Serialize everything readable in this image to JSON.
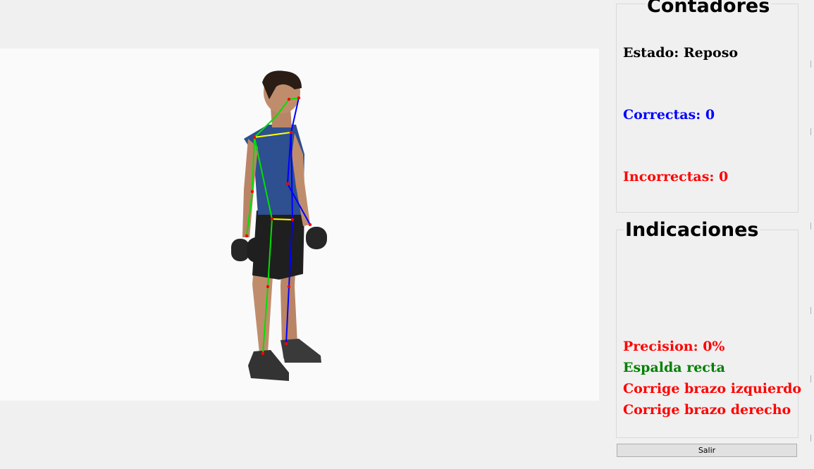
{
  "contadores": {
    "title": "Contadores",
    "estado": "Estado: Reposo",
    "correctas": "Correctas: 0",
    "incorrectas": "Incorrectas: 0"
  },
  "indicaciones": {
    "title": "Indicaciones",
    "messages": [
      {
        "text": "Precision: 0%",
        "color": "#ff0000"
      },
      {
        "text": "Espalda recta",
        "color": "#008000"
      },
      {
        "text": "Corrige brazo izquierdo",
        "color": "#ff0000"
      },
      {
        "text": "Corrige brazo derecho",
        "color": "#ff0000"
      }
    ]
  },
  "colors": {
    "correctas": "#0000ff",
    "incorrectas": "#ff0000",
    "skeleton_left": "#00e000",
    "skeleton_right": "#0000ff",
    "skeleton_cross": "#ffff00",
    "joint": "#ff0000"
  },
  "buttons": {
    "salir": "Salir"
  }
}
